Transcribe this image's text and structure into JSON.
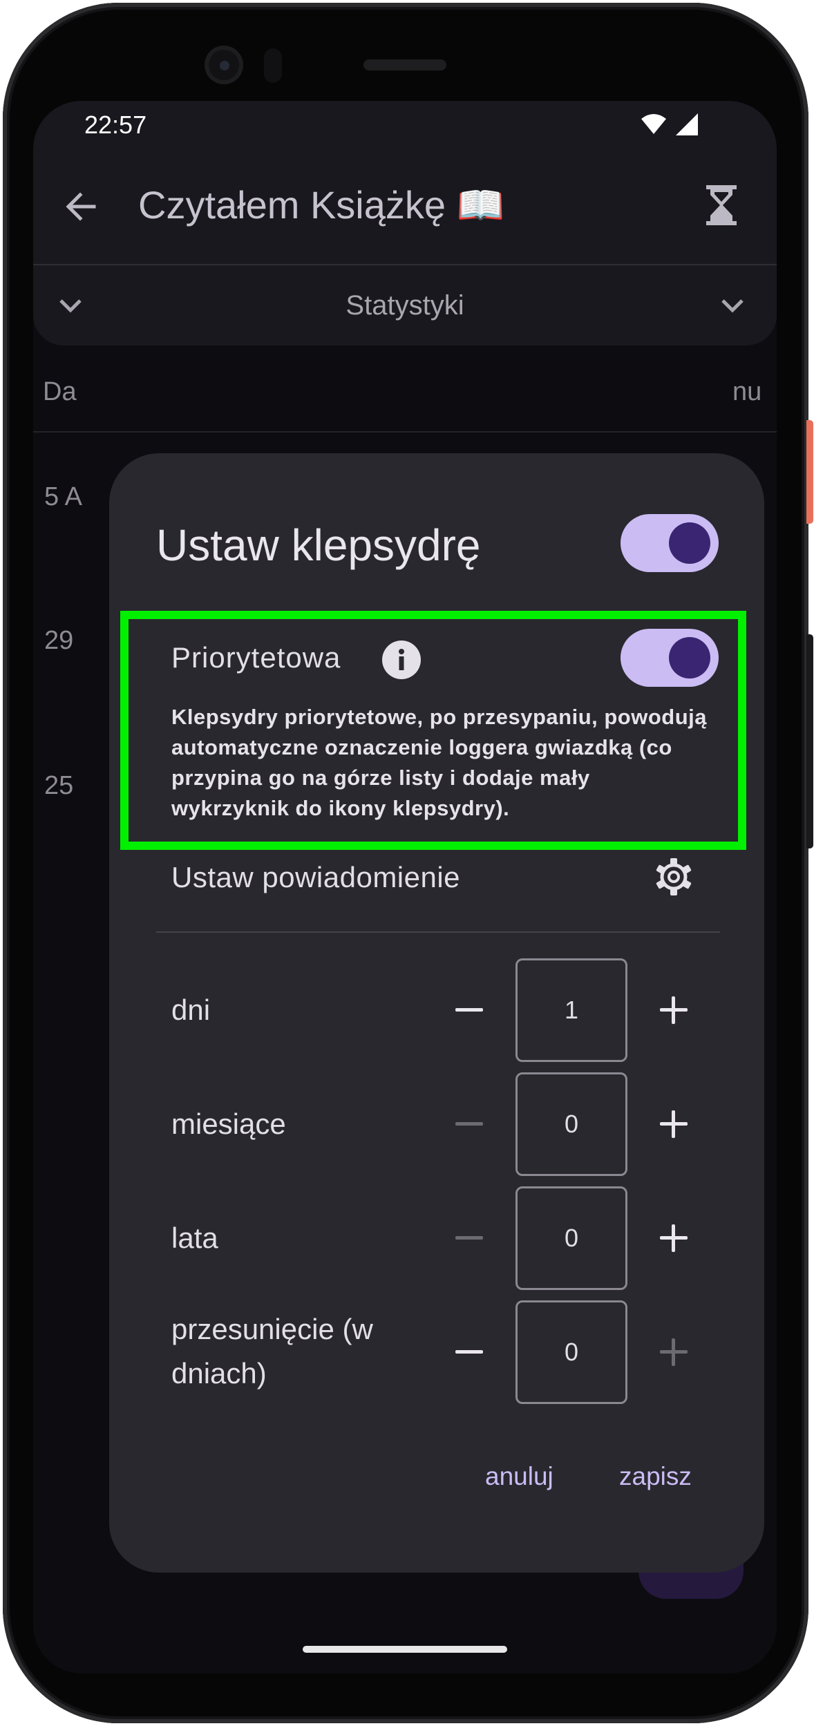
{
  "status_bar": {
    "time": "22:57"
  },
  "app_bar": {
    "title": "Czytałem Książkę 📖"
  },
  "stats": {
    "label": "Statystyki"
  },
  "background": {
    "col_left": "Da",
    "col_right": "nu",
    "row1": "5 A",
    "row2": "29",
    "row3": "25"
  },
  "dialog": {
    "title": "Ustaw klepsydrę",
    "priority_label": "Priorytetowa",
    "priority_description": "Klepsydry priorytetowe, po przesypaniu, powodują automatyczne oznaczenie loggera gwiazdką (co przypina go na górze listy i dodaje mały wykrzyknik do ikony klepsydry).",
    "notification_label": "Ustaw powiadomienie",
    "rows": [
      {
        "label": "dni",
        "value": "1"
      },
      {
        "label": "miesiące",
        "value": "0"
      },
      {
        "label": "lata",
        "value": "0"
      },
      {
        "label": "przesunięcie (w dniach)",
        "value": "0"
      }
    ],
    "cancel_label": "anuluj",
    "save_label": "zapisz"
  },
  "colors": {
    "accent": "#cbbcf4",
    "switch_thumb": "#3a2573",
    "dialog_bg": "#29282e",
    "highlight": "#00f000"
  },
  "icons": [
    "back-arrow-icon",
    "hourglass-icon",
    "chevron-down-icon",
    "info-icon",
    "gear-icon",
    "minus-icon",
    "plus-icon",
    "wifi-icon",
    "signal-icon"
  ]
}
